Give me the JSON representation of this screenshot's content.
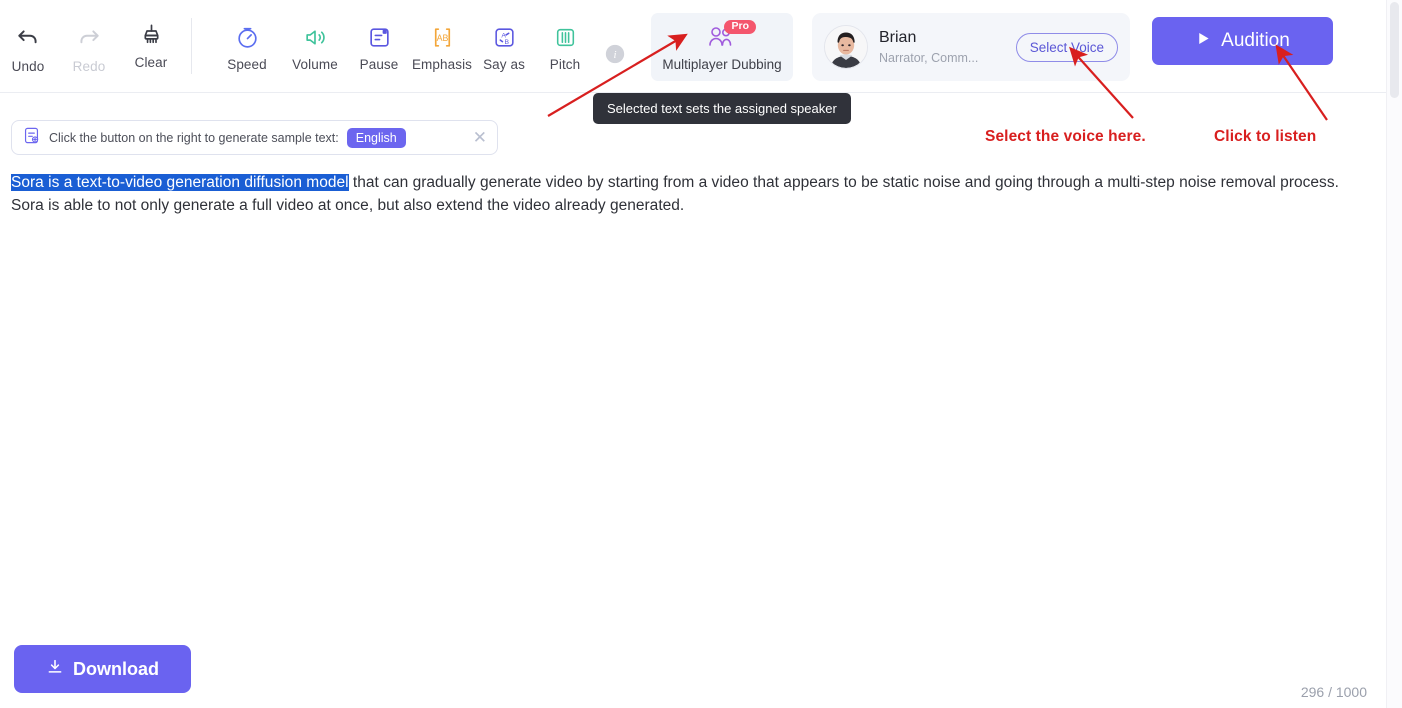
{
  "toolbar": {
    "items": [
      {
        "label": "Undo",
        "icon": "undo-arrow-icon",
        "disabled": false
      },
      {
        "label": "Redo",
        "icon": "redo-arrow-icon",
        "disabled": true
      },
      {
        "label": "Clear",
        "icon": "broom-clear-icon",
        "disabled": false
      },
      {
        "label": "Speed",
        "icon": "speed-gauge-icon",
        "disabled": false
      },
      {
        "label": "Volume",
        "icon": "speaker-volume-icon",
        "disabled": false
      },
      {
        "label": "Pause",
        "icon": "pause-insert-icon",
        "disabled": false
      },
      {
        "label": "Emphasis",
        "icon": "ab-emphasis-icon",
        "disabled": false
      },
      {
        "label": "Say as",
        "icon": "say-as-icon",
        "disabled": false
      },
      {
        "label": "Pitch",
        "icon": "pitch-sliders-icon",
        "disabled": false
      }
    ],
    "info_icon": "info-circle-icon"
  },
  "dubbing": {
    "label": "Multiplayer Dubbing",
    "badge": "Pro",
    "icon": "two-people-icon",
    "badge_color": "#f4566d",
    "background": "#f1f4f9"
  },
  "voice": {
    "name": "Brian",
    "tags": "Narrator, Comm...",
    "select_button": "Select Voice",
    "avatar_icon": "user-avatar-photo"
  },
  "audition": {
    "label": "Audition",
    "icon": "play-triangle-icon",
    "color": "#6a63f0"
  },
  "tooltip": {
    "text": "Selected text sets the assigned speaker"
  },
  "sample_bar": {
    "icon": "document-add-icon",
    "text": "Click the button on the right to generate sample text:",
    "language": "English",
    "close_icon": "close-x-icon"
  },
  "editor": {
    "selected_text": "Sora is a text-to-video generation diffusion model",
    "rest_text": " that can gradually generate video by starting from a video that appears to be static noise and going through a multi-step noise removal process. Sora is able to not only generate a full video at once, but also extend the video already generated.",
    "selection_color": "#1a5ed4"
  },
  "annotations": {
    "color": "#d81f1f",
    "items": [
      {
        "text": "Select the voice here."
      },
      {
        "text": "Click to listen"
      }
    ]
  },
  "footer": {
    "download_label": "Download",
    "download_icon": "download-arrow-icon",
    "counter": "296 / 1000"
  }
}
